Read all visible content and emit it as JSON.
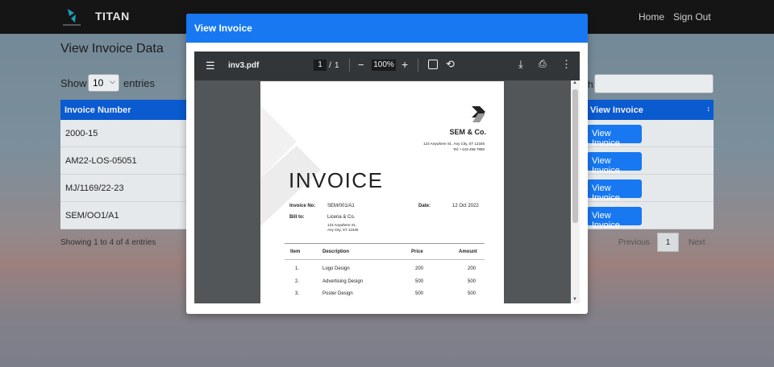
{
  "app": {
    "brand": "TITAN",
    "nav": {
      "home": "Home",
      "signout": "Sign Out"
    }
  },
  "page": {
    "title": "View Invoice Data",
    "show": "Show",
    "entries_value": "10",
    "entries_label": "entries",
    "search_label": "h:",
    "columns": {
      "invoice_number": "Invoice Number",
      "view_invoice": "View Invoice"
    },
    "rows": [
      {
        "invoice": "2000-15",
        "action": "View Invoice"
      },
      {
        "invoice": "AM22-LOS-05051",
        "action": "View Invoice"
      },
      {
        "invoice": "MJ/1169/22-23",
        "action": "View Invoice"
      },
      {
        "invoice": "SEM/OO1/A1",
        "action": "View Invoice"
      }
    ],
    "info": "Showing 1 to 4 of 4 entries",
    "pagination": {
      "previous": "Previous",
      "current": "1",
      "next": "Next"
    }
  },
  "modal": {
    "title": "View Invoice",
    "viewer": {
      "filename": "inv3.pdf",
      "page_current": "1",
      "page_sep": "/",
      "page_total": "1",
      "zoom": "100%"
    },
    "invoice": {
      "company": "SEM & Co.",
      "address": "123 Anywhere St., Any City, ST 12345",
      "tel": "Tel: +123-456-7890",
      "heading": "INVOICE",
      "invoice_no_label": "Invoice No:",
      "invoice_no": "SEM/001/A1",
      "date_label": "Date:",
      "date": "12 Oct 2022",
      "bill_to_label": "Bill to:",
      "bill_to_name": "Liceria & Co.",
      "bill_to_addr1": "123 Anywhere St.,",
      "bill_to_addr2": "Any City, ST 12345",
      "table_headers": {
        "item": "Item",
        "description": "Description",
        "price": "Price",
        "amount": "Amount"
      },
      "items": [
        {
          "item": "1.",
          "description": "Logo Design",
          "price": "200",
          "amount": "200"
        },
        {
          "item": "2.",
          "description": "Advertising Design",
          "price": "500",
          "amount": "500"
        },
        {
          "item": "3.",
          "description": "Poster Design",
          "price": "500",
          "amount": "500"
        }
      ]
    }
  },
  "colors": {
    "primary": "#1778f2",
    "table_header": "#0a5ad0",
    "navbar": "#151515",
    "viewer_toolbar": "#323639"
  }
}
